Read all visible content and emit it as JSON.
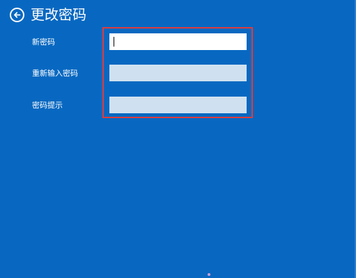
{
  "header": {
    "title": "更改密码",
    "back_icon": "back-arrow-icon"
  },
  "form": {
    "new_password": {
      "label": "新密码",
      "value": "",
      "active": true
    },
    "reenter_password": {
      "label": "重新输入密码",
      "value": "",
      "active": false
    },
    "password_hint": {
      "label": "密码提示",
      "value": "",
      "active": false
    }
  },
  "colors": {
    "background": "#0868c1",
    "highlight_border": "#e03c3c",
    "field_active": "#ffffff",
    "field_inactive": "#cfe1f0"
  }
}
